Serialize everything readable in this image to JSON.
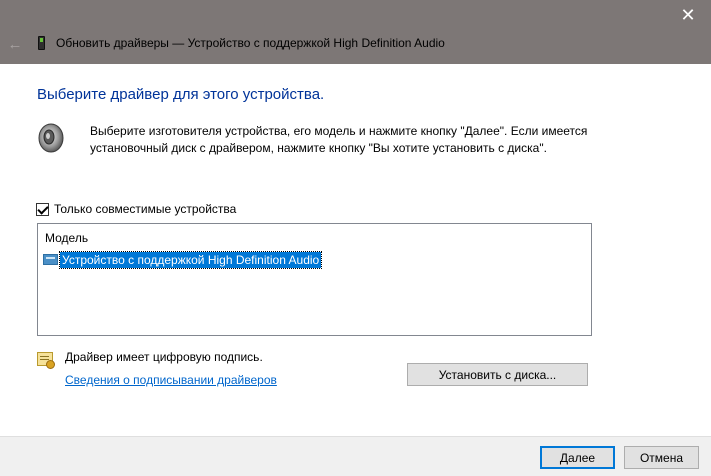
{
  "window": {
    "title": "Обновить драйверы — Устройство с поддержкой High Definition Audio",
    "close_glyph": "✕",
    "back_glyph": "←"
  },
  "heading": "Выберите драйвер для этого устройства.",
  "intro_text": "Выберите изготовителя устройства, его модель и нажмите кнопку \"Далее\". Если имеется установочный диск с  драйвером, нажмите кнопку \"Вы хотите установить с диска\".",
  "compatible_checkbox": {
    "label": "Только совместимые устройства",
    "checked": true
  },
  "model_list": {
    "header": "Модель",
    "items": [
      {
        "label": "Устройство с поддержкой High Definition Audio",
        "selected": true
      }
    ]
  },
  "signature": {
    "status_text": "Драйвер имеет цифровую подпись.",
    "link_text": "Сведения о подписывании драйверов"
  },
  "buttons": {
    "have_disk": "Установить с диска...",
    "next": "Далее",
    "cancel": "Отмена"
  },
  "icons": {
    "title": "device-icon",
    "speaker": "speaker-icon",
    "list_item": "audio-device-icon",
    "certificate": "certificate-icon"
  },
  "colors": {
    "titlebar": "#7d7776",
    "heading": "#003399",
    "selection": "#0078d7",
    "link": "#0066cc",
    "footer": "#f0f0f0"
  }
}
